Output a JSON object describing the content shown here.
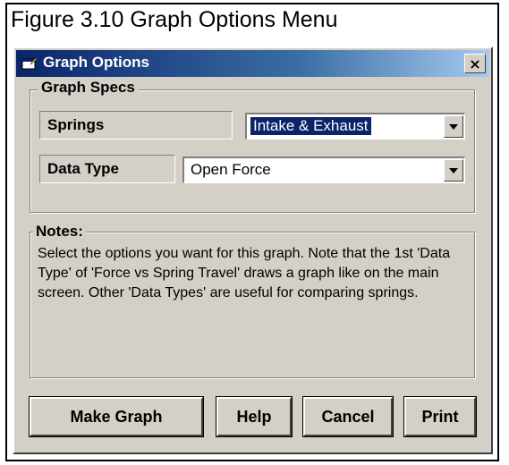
{
  "figure_caption": "Figure 3.10  Graph Options Menu",
  "window": {
    "title": "Graph Options",
    "close_label": "×"
  },
  "graph_specs": {
    "legend": "Graph Specs",
    "springs_label": "Springs",
    "springs_value": "Intake & Exhaust",
    "data_type_label": "Data Type",
    "data_type_value": "Open Force"
  },
  "notes": {
    "legend": "Notes:",
    "text": "Select the options you want for this graph.  Note that the 1st 'Data Type' of 'Force vs Spring Travel' draws a graph like on the main screen. Other 'Data Types' are useful for comparing springs."
  },
  "buttons": {
    "make_graph": "Make Graph",
    "help": "Help",
    "cancel": "Cancel",
    "print": "Print"
  },
  "colors": {
    "titlebar_start": "#0a246a",
    "titlebar_end": "#a6caf0",
    "dialog_bg": "#d4d0c8",
    "selection": "#0a246a"
  }
}
